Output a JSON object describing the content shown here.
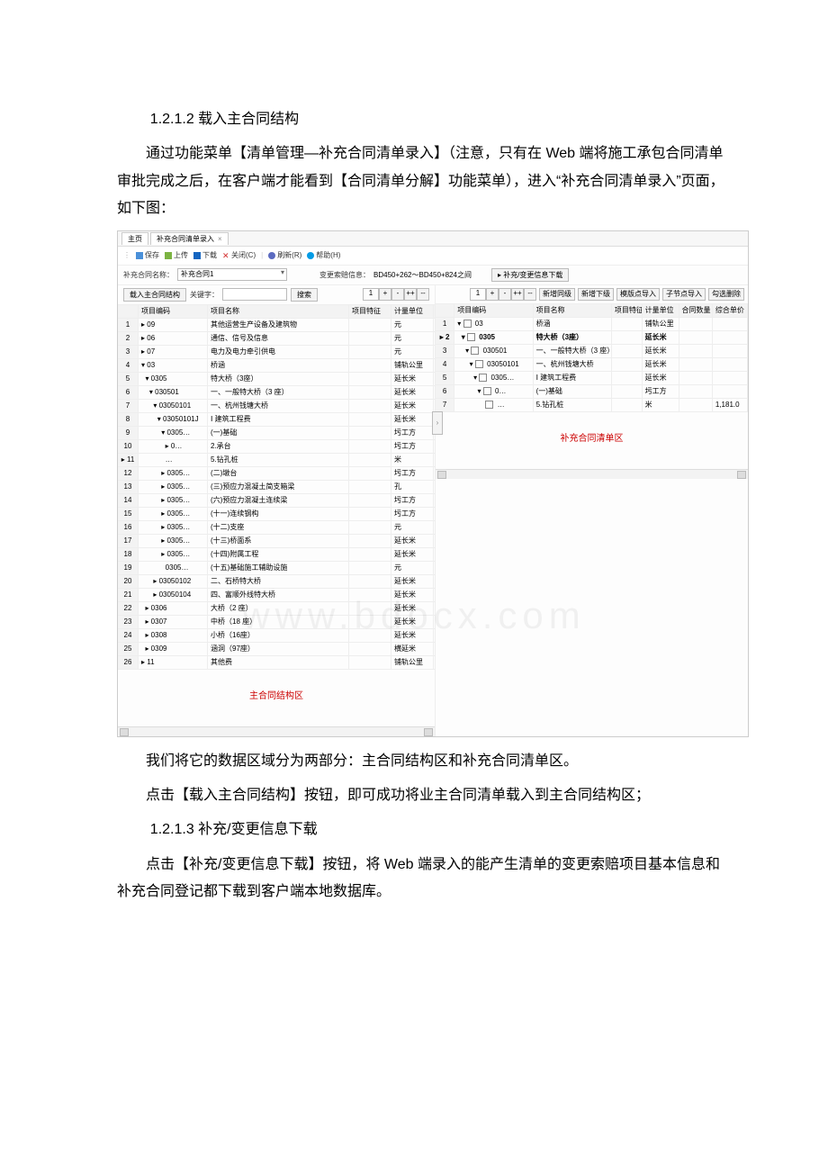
{
  "doc": {
    "h1": "1.2.1.2 载入主合同结构",
    "p1": "通过功能菜单【清单管理—补充合同清单录入】（注意，只有在 Web 端将施工承包合同清单审批完成之后，在客户端才能看到【合同清单分解】功能菜单），进入“补充合同清单录入”页面，如下图：",
    "p2": "我们将它的数据区域分为两部分：主合同结构区和补充合同清单区。",
    "p3": "点击【载入主合同结构】按钮，即可成功将业主合同清单载入到主合同结构区；",
    "h2": "1.2.1.3 补充/变更信息下载",
    "p4": "点击【补充/变更信息下载】按钮，将 Web 端录入的能产生清单的变更索赔项目基本信息和补充合同登记都下载到客户端本地数据库。",
    "watermark": "www.bdocx.com"
  },
  "ui": {
    "tabs": {
      "main": "主页",
      "page": "补充合同清单录入",
      "close": "×"
    },
    "toolbar": {
      "save": "保存",
      "upload": "上传",
      "download": "下载",
      "close": "关闭(C)",
      "refresh": "刷新(R)",
      "help": "帮助(H)"
    },
    "filter": {
      "name_label": "补充合同名称：",
      "name_value": "补充合同1",
      "info_label": "变更索赔信息：",
      "info_value": "BD450+262～BD450+824之间",
      "dlbtn": "▸ 补充/变更信息下载"
    },
    "kwbar": {
      "loadbtn": "载入主合同结构",
      "kw_label": "关键字：",
      "search": "搜索",
      "level": "1"
    },
    "rightbar": {
      "level": "1",
      "btns": [
        "新增同级",
        "新增下级",
        "模版点导入",
        "子节点导入",
        "勾选删除"
      ]
    },
    "left": {
      "cols": [
        "",
        "项目编码",
        "项目名称",
        "项目特征",
        "计量单位"
      ],
      "rows": [
        {
          "n": "1",
          "code": "▸ 09",
          "name": "其他运营生产设备及建筑物",
          "unit": "元"
        },
        {
          "n": "2",
          "code": "▸ 06",
          "name": "通信、信号及信息",
          "unit": "元"
        },
        {
          "n": "3",
          "code": "▸ 07",
          "name": "电力及电力牵引供电",
          "unit": "元"
        },
        {
          "n": "4",
          "code": "▾ 03",
          "name": "桥涵",
          "unit": "铺轨公里"
        },
        {
          "n": "5",
          "code": "  ▾ 0305",
          "name": "特大桥（3座）",
          "unit": "延长米"
        },
        {
          "n": "6",
          "code": "    ▾ 030501",
          "name": "一、一般特大桥（3 座）",
          "unit": "延长米"
        },
        {
          "n": "7",
          "code": "      ▾ 03050101",
          "name": "一、杭州钱塘大桥",
          "unit": "延长米"
        },
        {
          "n": "8",
          "code": "        ▾ 03050101J",
          "name": "Ⅰ 建筑工程费",
          "unit": "延长米"
        },
        {
          "n": "9",
          "code": "          ▾ 0305…",
          "name": "(一)基础",
          "unit": "圬工方"
        },
        {
          "n": "10",
          "code": "            ▸ 0…",
          "name": "2.承台",
          "unit": "圬工方"
        },
        {
          "n": "▸ 11",
          "code": "            …",
          "name": "5.钻孔桩",
          "unit": "米"
        },
        {
          "n": "12",
          "code": "          ▸ 0305…",
          "name": "(二)墩台",
          "unit": "圬工方"
        },
        {
          "n": "13",
          "code": "          ▸ 0305…",
          "name": "(三)预应力混凝土简支箱梁",
          "unit": "孔"
        },
        {
          "n": "14",
          "code": "          ▸ 0305…",
          "name": "(六)预应力混凝土连续梁",
          "unit": "圬工方"
        },
        {
          "n": "15",
          "code": "          ▸ 0305…",
          "name": "(十一)连续钢构",
          "unit": "圬工方"
        },
        {
          "n": "16",
          "code": "          ▸ 0305…",
          "name": "(十二)支座",
          "unit": "元"
        },
        {
          "n": "17",
          "code": "          ▸ 0305…",
          "name": "(十三)桥面系",
          "unit": "延长米"
        },
        {
          "n": "18",
          "code": "          ▸ 0305…",
          "name": "(十四)附属工程",
          "unit": "延长米"
        },
        {
          "n": "19",
          "code": "            0305…",
          "name": "(十五)基础施工辅助设施",
          "unit": "元"
        },
        {
          "n": "20",
          "code": "      ▸ 03050102",
          "name": "二、石桥特大桥",
          "unit": "延长米"
        },
        {
          "n": "21",
          "code": "      ▸ 03050104",
          "name": "四、富顺外线特大桥",
          "unit": "延长米"
        },
        {
          "n": "22",
          "code": "  ▸ 0306",
          "name": "大桥（2 座）",
          "unit": "延长米"
        },
        {
          "n": "23",
          "code": "  ▸ 0307",
          "name": "中桥（18 座）",
          "unit": "延长米"
        },
        {
          "n": "24",
          "code": "  ▸ 0308",
          "name": "小桥（16座）",
          "unit": "延长米"
        },
        {
          "n": "25",
          "code": "  ▸ 0309",
          "name": "涵洞（97座）",
          "unit": "横延米"
        },
        {
          "n": "26",
          "code": "▸ 11",
          "name": "其他费",
          "unit": "铺轨公里"
        }
      ],
      "caption": "主合同结构区"
    },
    "right": {
      "cols": [
        "",
        "项目编码",
        "项目名称",
        "项目特征",
        "计量单位",
        "合同数量",
        "综合单价"
      ],
      "rows": [
        {
          "n": "1",
          "code": "▾ ☐ 03",
          "name": "桥涵",
          "unit": "铺轨公里"
        },
        {
          "n": "▸ 2",
          "code": "  ▾ ☐ 0305",
          "name": "特大桥（3座）",
          "unit": "延长米",
          "bold": true
        },
        {
          "n": "3",
          "code": "    ▾ ☐ 030501",
          "name": "一、一般特大桥（3 座）",
          "unit": "延长米"
        },
        {
          "n": "4",
          "code": "      ▾ ☐ 03050101",
          "name": "一、杭州钱塘大桥",
          "unit": "延长米"
        },
        {
          "n": "5",
          "code": "        ▾ ☐ 0305…",
          "name": "Ⅰ 建筑工程费",
          "unit": "延长米"
        },
        {
          "n": "6",
          "code": "          ▾ ☐ 0…",
          "name": "(一)基础",
          "unit": "圬工方"
        },
        {
          "n": "7",
          "code": "              ☐ …",
          "name": "5.钻孔桩",
          "unit": "米",
          "price": "1,181.0"
        }
      ],
      "caption": "补充合同清单区"
    }
  }
}
